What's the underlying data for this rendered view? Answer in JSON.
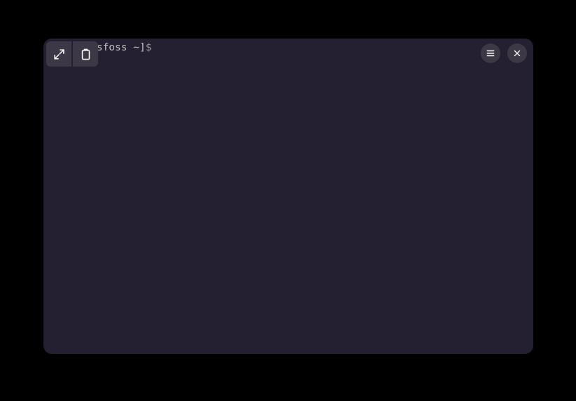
{
  "terminal": {
    "prompt_text": "[   i  tsfoss ~]",
    "prompt_symbol": "$"
  },
  "icons": {
    "expand": "expand-icon",
    "copy": "copy-icon",
    "menu": "hamburger-icon",
    "close": "close-icon"
  }
}
